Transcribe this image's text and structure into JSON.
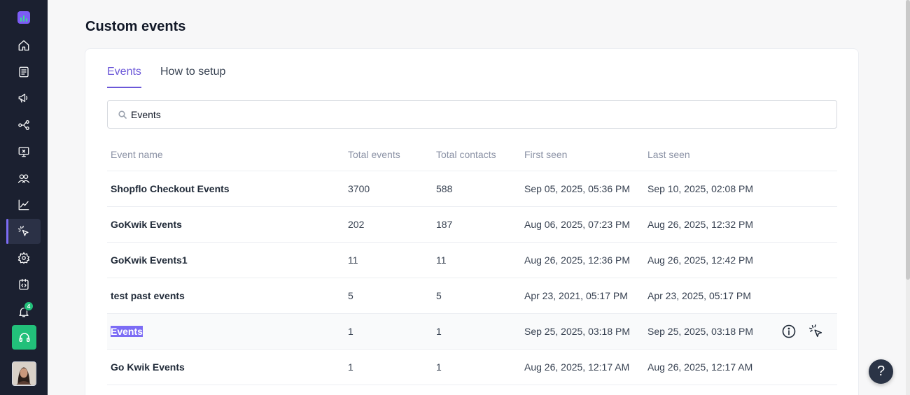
{
  "page": {
    "title": "Custom events"
  },
  "tabs": [
    {
      "label": "Events",
      "active": true
    },
    {
      "label": "How to setup",
      "active": false
    }
  ],
  "search": {
    "value": "Events",
    "placeholder": "Search"
  },
  "table": {
    "columns": [
      "Event name",
      "Total events",
      "Total contacts",
      "First seen",
      "Last seen"
    ],
    "rows": [
      {
        "name": "Shopflo Checkout Events",
        "total_events": "3700",
        "total_contacts": "588",
        "first_seen": "Sep 05, 2025, 05:36 PM",
        "last_seen": "Sep 10, 2025, 02:08 PM"
      },
      {
        "name": "GoKwik Events",
        "total_events": "202",
        "total_contacts": "187",
        "first_seen": "Aug 06, 2025, 07:23 PM",
        "last_seen": "Aug 26, 2025, 12:32 PM"
      },
      {
        "name": "GoKwik Events1",
        "total_events": "11",
        "total_contacts": "11",
        "first_seen": "Aug 26, 2025, 12:36 PM",
        "last_seen": "Aug 26, 2025, 12:42 PM"
      },
      {
        "name": "test past events",
        "total_events": "5",
        "total_contacts": "5",
        "first_seen": "Apr 23, 2021, 05:17 PM",
        "last_seen": "Apr 23, 2025, 05:17 PM"
      },
      {
        "name": "Events",
        "total_events": "1",
        "total_contacts": "1",
        "first_seen": "Sep 25, 2025, 03:18 PM",
        "last_seen": "Sep 25, 2025, 03:18 PM",
        "hovered": true
      },
      {
        "name": "Go Kwik Events",
        "total_events": "1",
        "total_contacts": "1",
        "first_seen": "Aug 26, 2025, 12:17 AM",
        "last_seen": "Aug 26, 2025, 12:17 AM"
      }
    ]
  },
  "sidebar": {
    "items": [
      "home-icon",
      "document-icon",
      "megaphone-icon",
      "flow-icon",
      "screen-icon",
      "users-icon",
      "chart-icon",
      "cursor-click-icon",
      "gear-icon",
      "code-icon",
      "bell-icon"
    ],
    "active_item": "cursor-click-icon",
    "notification_count": "4"
  },
  "help_label": "?",
  "colors": {
    "accent": "#6b57d8",
    "sidebar_bg": "#1b2030",
    "support_green": "#22c07a"
  }
}
